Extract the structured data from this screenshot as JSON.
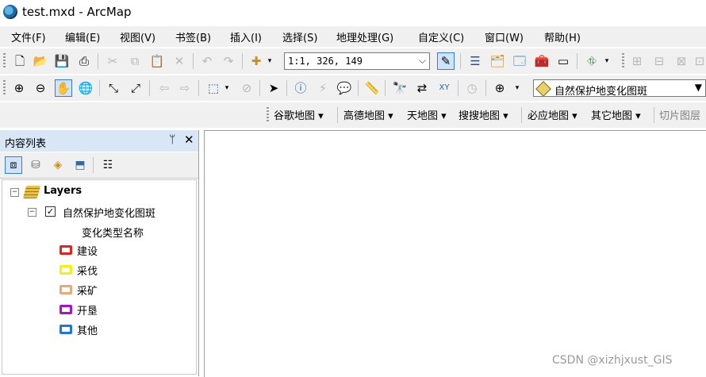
{
  "window": {
    "title": "test.mxd - ArcMap"
  },
  "menu": [
    "文件(F)",
    "编辑(E)",
    "视图(V)",
    "书签(B)",
    "插入(I)",
    "选择(S)",
    "地理处理(G)",
    "自定义(C)",
    "窗口(W)",
    "帮助(H)"
  ],
  "toolbar": {
    "scale_value": "1:1, 326, 149"
  },
  "tools": {
    "target_layer": "自然保护地变化图斑"
  },
  "web_maps": [
    "谷歌地图",
    "高德地图",
    "天地图",
    "搜搜地图",
    "必应地图",
    "其它地图",
    "切片图层"
  ],
  "toc": {
    "title": "内容列表",
    "pin_glyph": "ᛘ",
    "close_glyph": "✕",
    "root": "Layers",
    "layer": "自然保护地变化图斑",
    "field": "变化类型名称",
    "legend": [
      {
        "label": "建设",
        "color": "#e8221c"
      },
      {
        "label": "采伐",
        "color": "#f5f013"
      },
      {
        "label": "采矿",
        "color": "#eea877"
      },
      {
        "label": "开垦",
        "color": "#a813c8"
      },
      {
        "label": "其他",
        "color": "#1a78e0"
      }
    ]
  },
  "watermark": "CSDN @xizhjxust_GIS"
}
